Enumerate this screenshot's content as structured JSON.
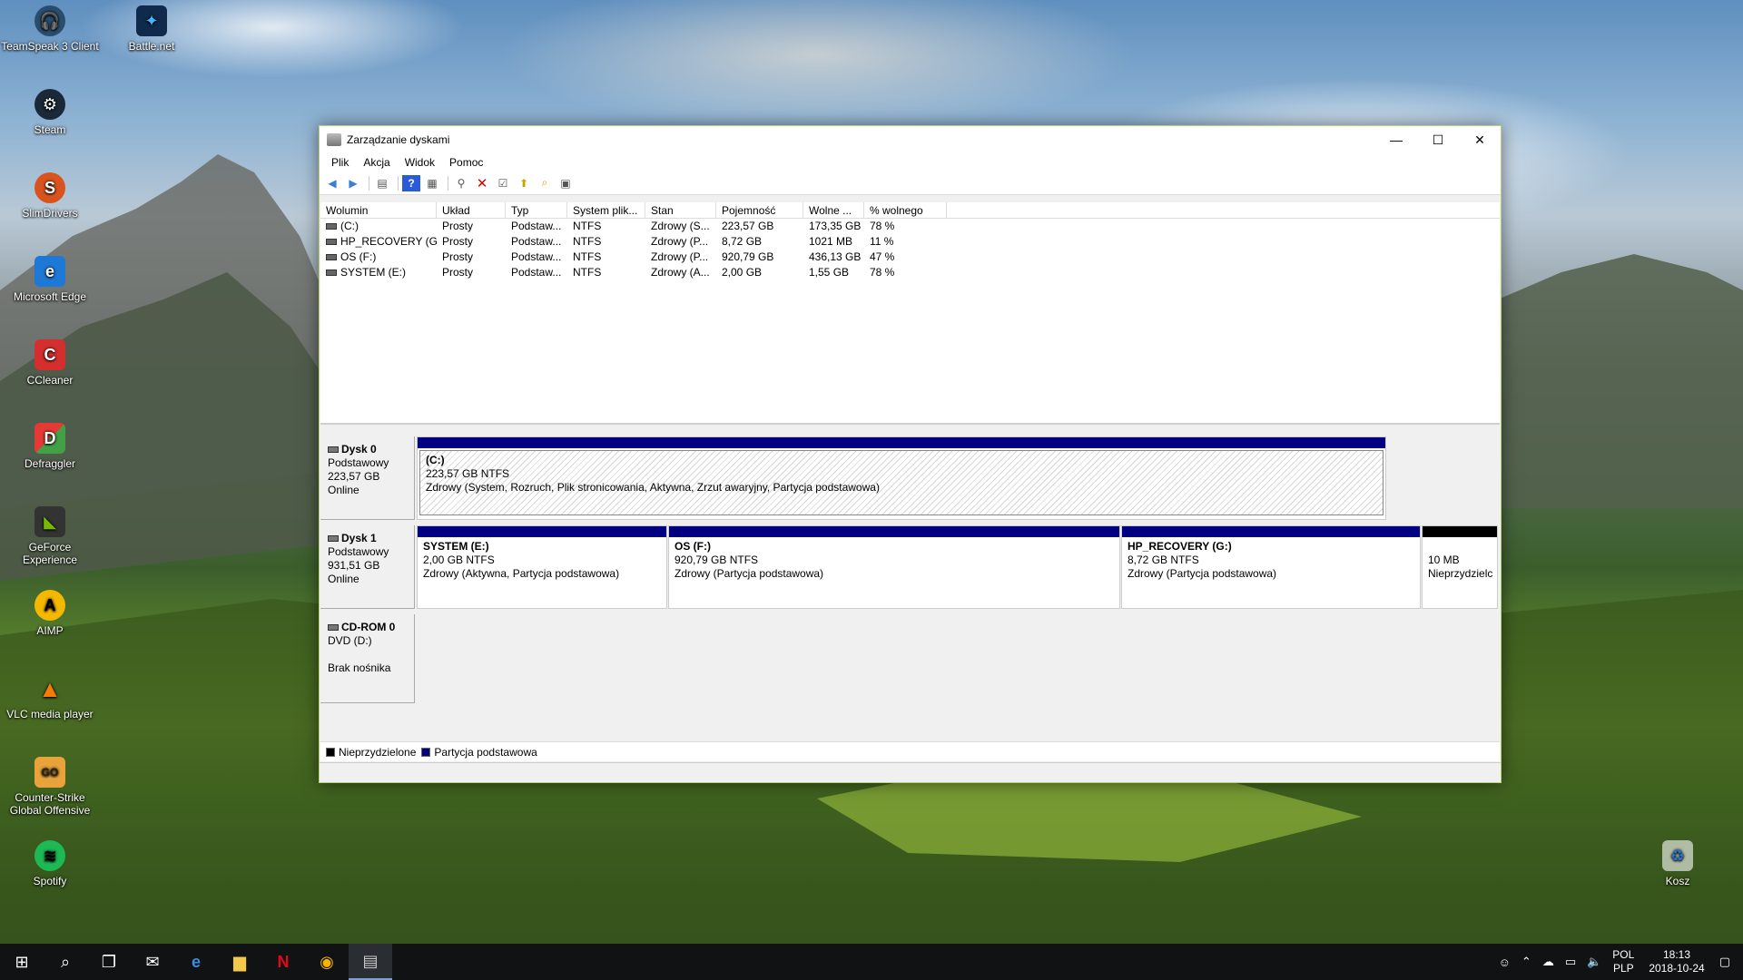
{
  "desktop": {
    "icons": [
      {
        "label": "TeamSpeak 3 Client",
        "icon": "teamspeak-icon"
      },
      {
        "label": "Battle.net",
        "icon": "battlenet-icon"
      },
      {
        "label": "Steam",
        "icon": "steam-icon"
      },
      {
        "label": "SlimDrivers",
        "icon": "slimdrivers-icon"
      },
      {
        "label": "Microsoft Edge",
        "icon": "edge-icon"
      },
      {
        "label": "CCleaner",
        "icon": "ccleaner-icon"
      },
      {
        "label": "Defraggler",
        "icon": "defraggler-icon"
      },
      {
        "label": "GeForce Experience",
        "icon": "geforce-icon"
      },
      {
        "label": "AIMP",
        "icon": "aimp-icon"
      },
      {
        "label": "VLC media player",
        "icon": "vlc-icon"
      },
      {
        "label": "Counter-Strike Global Offensive",
        "icon": "csgo-icon"
      },
      {
        "label": "Spotify",
        "icon": "spotify-icon"
      },
      {
        "label": "Kosz",
        "icon": "recycle-bin-icon"
      }
    ]
  },
  "window": {
    "title": "Zarządzanie dyskami",
    "controls": {
      "minimize": "—",
      "maximize": "☐",
      "close": "✕"
    },
    "menu": [
      "Plik",
      "Akcja",
      "Widok",
      "Pomoc"
    ],
    "columns": [
      "Wolumin",
      "Układ",
      "Typ",
      "System plik...",
      "Stan",
      "Pojemność",
      "Wolne ...",
      "% wolnego"
    ],
    "volumes": [
      {
        "name": "(C:)",
        "layout": "Prosty",
        "type": "Podstaw...",
        "fs": "NTFS",
        "status": "Zdrowy (S...",
        "capacity": "223,57 GB",
        "free": "173,35 GB",
        "pct": "78 %"
      },
      {
        "name": "HP_RECOVERY (G:)",
        "layout": "Prosty",
        "type": "Podstaw...",
        "fs": "NTFS",
        "status": "Zdrowy (P...",
        "capacity": "8,72 GB",
        "free": "1021 MB",
        "pct": "11 %"
      },
      {
        "name": "OS (F:)",
        "layout": "Prosty",
        "type": "Podstaw...",
        "fs": "NTFS",
        "status": "Zdrowy (P...",
        "capacity": "920,79 GB",
        "free": "436,13 GB",
        "pct": "47 %"
      },
      {
        "name": "SYSTEM (E:)",
        "layout": "Prosty",
        "type": "Podstaw...",
        "fs": "NTFS",
        "status": "Zdrowy (A...",
        "capacity": "2,00 GB",
        "free": "1,55 GB",
        "pct": "78 %"
      }
    ],
    "disks": {
      "disk0": {
        "name": "Dysk 0",
        "type": "Podstawowy",
        "size": "223,57 GB",
        "state": "Online",
        "partitions": [
          {
            "name": "(C:)",
            "size": "223,57 GB NTFS",
            "status": "Zdrowy (System, Rozruch, Plik stronicowania, Aktywna, Zrzut awaryjny, Partycja podstawowa)"
          }
        ]
      },
      "disk1": {
        "name": "Dysk 1",
        "type": "Podstawowy",
        "size": "931,51 GB",
        "state": "Online",
        "partitions": [
          {
            "name": "SYSTEM  (E:)",
            "size": "2,00 GB NTFS",
            "status": "Zdrowy (Aktywna, Partycja podstawowa)"
          },
          {
            "name": "OS  (F:)",
            "size": "920,79 GB NTFS",
            "status": "Zdrowy (Partycja podstawowa)"
          },
          {
            "name": "HP_RECOVERY  (G:)",
            "size": "8,72 GB NTFS",
            "status": "Zdrowy (Partycja podstawowa)"
          },
          {
            "name": "",
            "size": "10 MB",
            "status": "Nieprzydzielc"
          }
        ]
      },
      "cdrom0": {
        "name": "CD-ROM 0",
        "type": "DVD (D:)",
        "state": "Brak nośnika"
      }
    },
    "legend": {
      "unallocated": "Nieprzydzielone",
      "primary": "Partycja podstawowa"
    },
    "colors": {
      "primary": "#000080",
      "unallocated": "#000000"
    }
  },
  "taskbar": {
    "lang1": "POL",
    "lang2": "PLP",
    "time": "18:13",
    "date": "2018-10-24"
  }
}
